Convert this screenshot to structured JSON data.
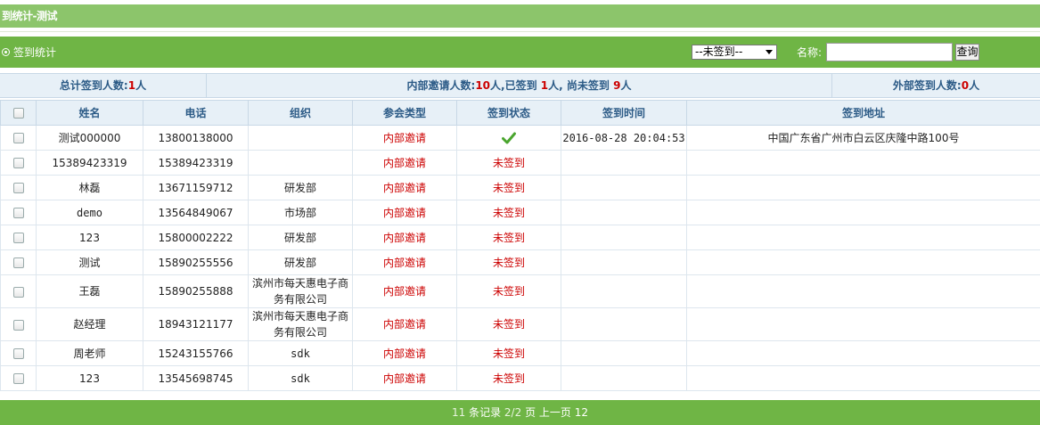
{
  "header": {
    "title": "到统计-测试"
  },
  "toolbar": {
    "label": "签到统计",
    "status_select": "--未签到--",
    "name_label": "名称:",
    "name_input_value": "",
    "search_button": "查询"
  },
  "summary": {
    "total_label": "总计签到人数:",
    "total_count": "1",
    "unit": "人",
    "internal_label": "内部邀请人数:",
    "internal_count": "10",
    "signed_label": "已签到",
    "signed_count": "1",
    "unsigned_label": "尚未签到",
    "unsigned_count": "9",
    "external_label": "外部签到人数:",
    "external_count": "0"
  },
  "table": {
    "columns": [
      "姓名",
      "电话",
      "组织",
      "参会类型",
      "签到状态",
      "签到时间",
      "签到地址"
    ],
    "rows": [
      {
        "name": "测试000000",
        "phone": "13800138000",
        "org": "",
        "type": "内部邀请",
        "status": "",
        "signed": true,
        "time": "2016-08-28 20:04:53",
        "address": "中国广东省广州市白云区庆隆中路100号"
      },
      {
        "name": "15389423319",
        "phone": "15389423319",
        "org": "",
        "type": "内部邀请",
        "status": "未签到",
        "signed": false,
        "time": "",
        "address": ""
      },
      {
        "name": "林磊",
        "phone": "13671159712",
        "org": "研发部",
        "type": "内部邀请",
        "status": "未签到",
        "signed": false,
        "time": "",
        "address": ""
      },
      {
        "name": "demo",
        "phone": "13564849067",
        "org": "市场部",
        "type": "内部邀请",
        "status": "未签到",
        "signed": false,
        "time": "",
        "address": ""
      },
      {
        "name": "123",
        "phone": "15800002222",
        "org": "研发部",
        "type": "内部邀请",
        "status": "未签到",
        "signed": false,
        "time": "",
        "address": ""
      },
      {
        "name": "测试",
        "phone": "15890255556",
        "org": "研发部",
        "type": "内部邀请",
        "status": "未签到",
        "signed": false,
        "time": "",
        "address": ""
      },
      {
        "name": "王磊",
        "phone": "15890255888",
        "org": "滨州市每天惠电子商务有限公司",
        "type": "内部邀请",
        "status": "未签到",
        "signed": false,
        "time": "",
        "address": ""
      },
      {
        "name": "赵经理",
        "phone": "18943121177",
        "org": "滨州市每天惠电子商务有限公司",
        "type": "内部邀请",
        "status": "未签到",
        "signed": false,
        "time": "",
        "address": ""
      },
      {
        "name": "周老师",
        "phone": "15243155766",
        "org": "sdk",
        "type": "内部邀请",
        "status": "未签到",
        "signed": false,
        "time": "",
        "address": ""
      },
      {
        "name": "123",
        "phone": "13545698745",
        "org": "sdk",
        "type": "内部邀请",
        "status": "未签到",
        "signed": false,
        "time": "",
        "address": ""
      }
    ]
  },
  "footer": {
    "records_count": "11",
    "records_label": "条记录",
    "page_info": "2/2",
    "page_label": "页",
    "prev_label": "上一页",
    "page_1": "1",
    "page_2": "2"
  },
  "colors": {
    "header_green": "#8cc56b",
    "toolbar_green": "#6fb545",
    "header_blue": "#2b5a86",
    "alert_red": "#cc0000",
    "check_green": "#4aa52e"
  }
}
